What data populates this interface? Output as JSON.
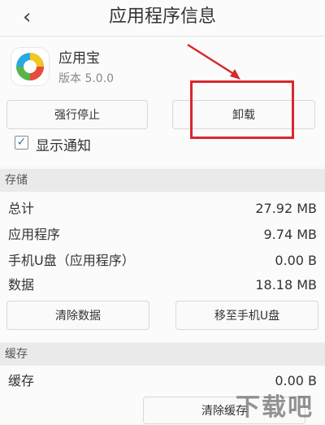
{
  "header": {
    "back_glyph": "‹",
    "title": "应用程序信息"
  },
  "app": {
    "name": "应用宝",
    "version": "版本 5.0.0",
    "icon": "app-logo-icon"
  },
  "buttons": {
    "force_stop": "强行停止",
    "uninstall": "卸载"
  },
  "notify": {
    "label": "显示通知",
    "checked": true
  },
  "storage": {
    "header": "存储",
    "rows": [
      {
        "label": "总计",
        "value": "27.92 MB"
      },
      {
        "label": "应用程序",
        "value": "9.74 MB"
      },
      {
        "label": "手机U盘（应用程序）",
        "value": "0.00 B"
      },
      {
        "label": "数据",
        "value": "18.18 MB"
      }
    ],
    "clear_data": "清除数据",
    "move_to_usb": "移至手机U盘"
  },
  "cache": {
    "header": "缓存",
    "label": "缓存",
    "value": "0.00 B",
    "clear_cache": "清除缓存"
  },
  "watermark": "下载吧",
  "colors": {
    "annotation": "#d9272e",
    "check": "#2a7a9b"
  }
}
